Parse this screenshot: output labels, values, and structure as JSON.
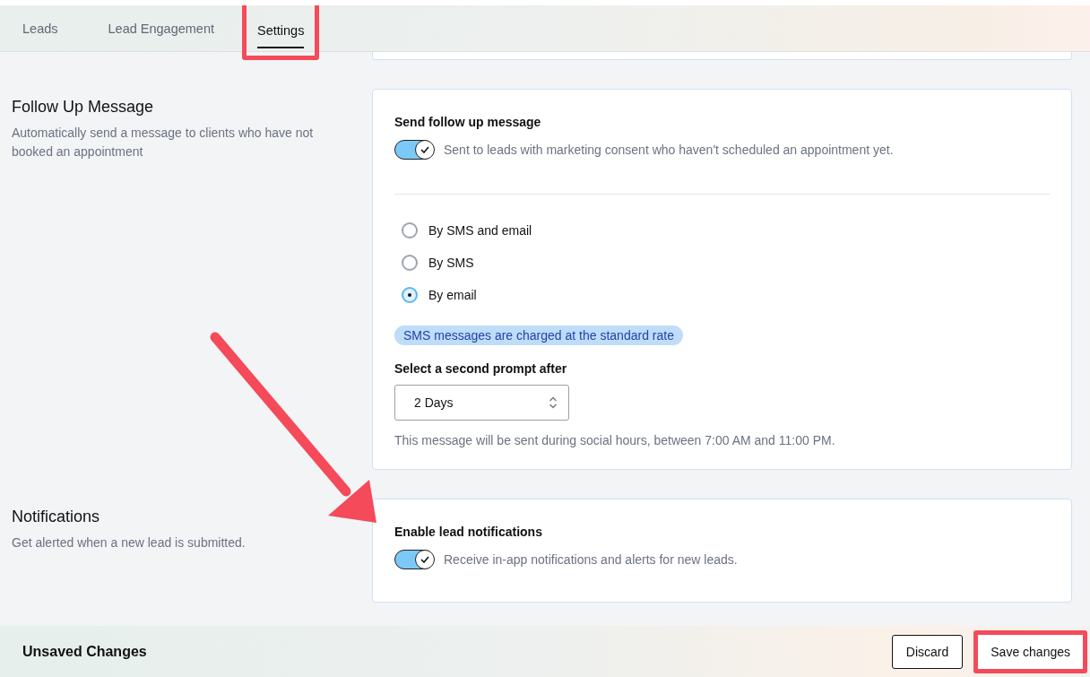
{
  "tabs": [
    {
      "label": "Leads",
      "selected": false,
      "highlighted": false
    },
    {
      "label": "Lead Engagement",
      "selected": false,
      "highlighted": false
    },
    {
      "label": "Settings",
      "selected": true,
      "highlighted": true
    }
  ],
  "follow_up": {
    "title": "Follow Up Message",
    "description": "Automatically send a message to clients who have not booked an appointment",
    "setting_label": "Send follow up message",
    "toggle": {
      "on": true,
      "description": "Sent to leads with marketing consent who haven't scheduled an appointment yet."
    },
    "channels": [
      {
        "label": "By SMS and email",
        "selected": false
      },
      {
        "label": "By SMS",
        "selected": false
      },
      {
        "label": "By email",
        "selected": true
      }
    ],
    "badge": "SMS messages are charged at the standard rate",
    "select_label": "Select a second prompt after",
    "select_value": "2 Days",
    "hint": "This message will be sent during social hours, between 7:00 AM and 11:00 PM."
  },
  "notifications": {
    "title": "Notifications",
    "description": "Get alerted when a new lead is submitted.",
    "setting_label": "Enable lead notifications",
    "toggle": {
      "on": true,
      "description": "Receive in-app notifications and alerts for new leads."
    }
  },
  "footer": {
    "status": "Unsaved Changes",
    "buttons": [
      {
        "label": "Discard",
        "kind": "secondary",
        "highlighted": false
      },
      {
        "label": "Save changes",
        "kind": "primary",
        "highlighted": true
      }
    ]
  }
}
